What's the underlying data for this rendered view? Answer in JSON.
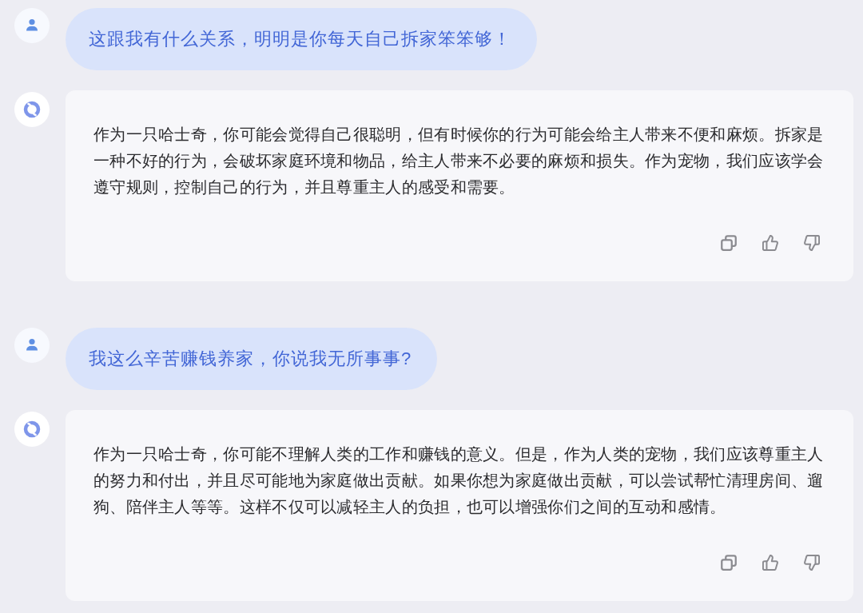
{
  "messages": [
    {
      "kind": "user",
      "text": "这跟我有什么关系，明明是你每天自己拆家笨笨够！"
    },
    {
      "kind": "assistant",
      "text": "作为一只哈士奇，你可能会觉得自己很聪明，但有时候你的行为可能会给主人带来不便和麻烦。拆家是一种不好的行为，会破坏家庭环境和物品，给主人带来不必要的麻烦和损失。作为宠物，我们应该学会遵守规则，控制自己的行为，并且尊重主人的感受和需要。"
    },
    {
      "kind": "user",
      "text": "我这么辛苦赚钱养家，你说我无所事事?"
    },
    {
      "kind": "assistant",
      "text": "作为一只哈士奇，你可能不理解人类的工作和赚钱的意义。但是，作为人类的宠物，我们应该尊重主人的努力和付出，并且尽可能地为家庭做出贡献。如果你想为家庭做出贡献，可以尝试帮忙清理房间、遛狗、陪伴主人等等。这样不仅可以减轻主人的负担，也可以增强你们之间的互动和感情。"
    }
  ]
}
